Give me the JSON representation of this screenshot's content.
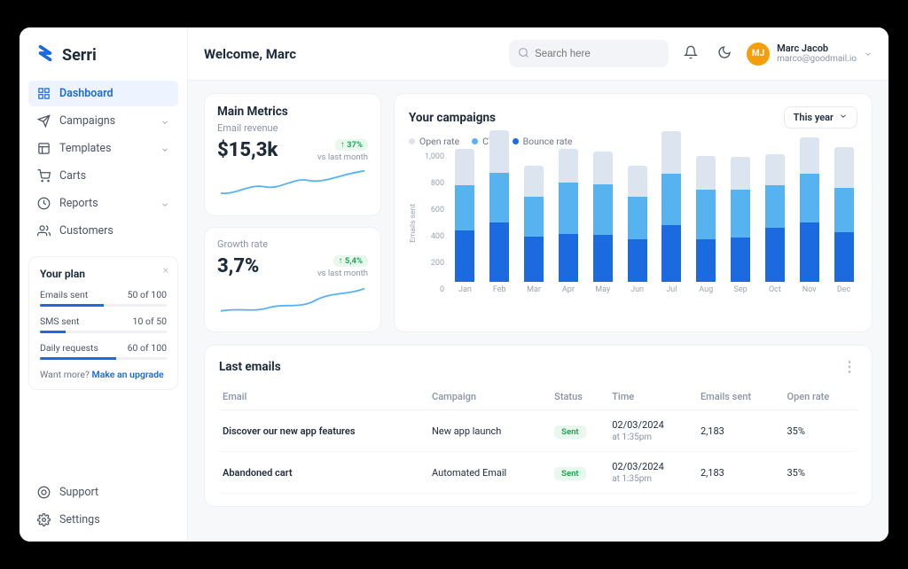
{
  "brand": {
    "name": "Serri"
  },
  "header": {
    "welcome": "Welcome, Marc",
    "search_placeholder": "Search here",
    "user_name": "Marc Jacob",
    "user_email": "marco@goodmail.io",
    "user_initials": "MJ"
  },
  "sidebar": {
    "items": [
      {
        "label": "Dashboard"
      },
      {
        "label": "Campaigns"
      },
      {
        "label": "Templates"
      },
      {
        "label": "Carts"
      },
      {
        "label": "Reports"
      },
      {
        "label": "Customers"
      }
    ],
    "bottom": [
      {
        "label": "Support"
      },
      {
        "label": "Settings"
      }
    ]
  },
  "plan": {
    "title": "Your plan",
    "rows": [
      {
        "label": "Emails sent",
        "value": "50 of 100",
        "pct": 50
      },
      {
        "label": "SMS sent",
        "value": "10 of 50",
        "pct": 20
      },
      {
        "label": "Daily requests",
        "value": "60 of 100",
        "pct": 60
      }
    ],
    "foot_prefix": "Want more? ",
    "foot_link": "Make an upgrade"
  },
  "metrics": {
    "section_title": "Main Metrics",
    "revenue": {
      "label": "Email revenue",
      "value": "$15,3k",
      "delta": "↑ 37%",
      "compare": "vs last month"
    },
    "growth": {
      "label": "Growth rate",
      "value": "3,7%",
      "delta": "↑ 5,4%",
      "compare": "vs last month"
    }
  },
  "campaigns": {
    "title": "Your campaigns",
    "range": "This year",
    "y_axis_title": "Emails sent",
    "legend": [
      {
        "label": "Open rate",
        "color": "#dbe4ef"
      },
      {
        "label": "CTR",
        "color": "#56b3f0"
      },
      {
        "label": "Bounce rate",
        "color": "#1b6ae0"
      }
    ]
  },
  "chart_data": {
    "type": "bar",
    "title": "Your campaigns",
    "ylabel": "Emails sent",
    "ylim": [
      0,
      1000
    ],
    "yticks": [
      0,
      200,
      400,
      600,
      800,
      1000
    ],
    "categories": [
      "Jan",
      "Feb",
      "Mar",
      "Apr",
      "May",
      "Jun",
      "Jul",
      "Aug",
      "Sep",
      "Oct",
      "Nov",
      "Dec"
    ],
    "series": [
      {
        "name": "Bounce rate",
        "color": "#1b6ae0",
        "values": [
          360,
          420,
          320,
          340,
          330,
          300,
          400,
          300,
          310,
          380,
          420,
          350
        ]
      },
      {
        "name": "CTR",
        "color": "#56b3f0",
        "values": [
          320,
          350,
          280,
          360,
          360,
          300,
          360,
          350,
          340,
          300,
          340,
          310
        ]
      },
      {
        "name": "Open rate",
        "color": "#dbe4ef",
        "values": [
          260,
          300,
          220,
          240,
          230,
          220,
          300,
          240,
          230,
          220,
          260,
          290
        ]
      }
    ]
  },
  "emails_table": {
    "title": "Last emails",
    "columns": [
      "Email",
      "Campaign",
      "Status",
      "Time",
      "Emails sent",
      "Open rate"
    ],
    "rows": [
      {
        "email": "Discover our new app features",
        "campaign": "New app launch",
        "status": "Sent",
        "time_date": "02/03/2024",
        "time_at": "at 1:35pm",
        "sent": "2,183",
        "open": "35%"
      },
      {
        "email": "Abandoned cart",
        "campaign": "Automated Email",
        "status": "Sent",
        "time_date": "02/03/2024",
        "time_at": "at 1:35pm",
        "sent": "2,183",
        "open": "35%"
      }
    ]
  }
}
